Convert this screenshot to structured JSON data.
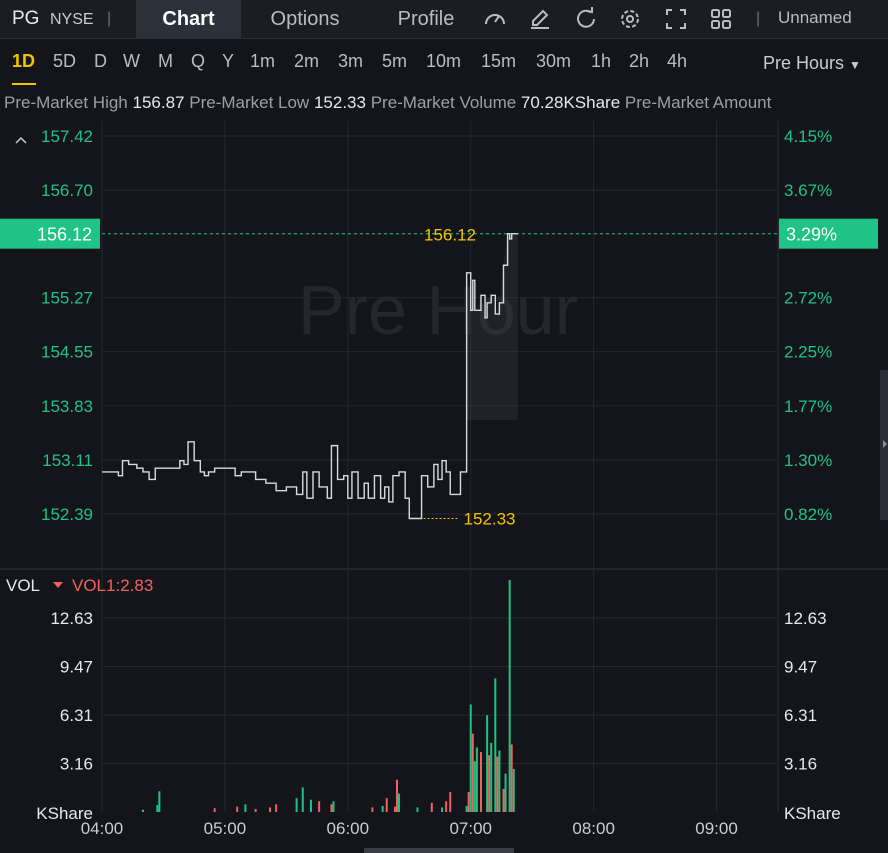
{
  "header": {
    "symbol": "PG",
    "exchange": "NYSE",
    "separator": "|",
    "tabs": [
      {
        "label": "Chart",
        "active": true
      },
      {
        "label": "Options",
        "active": false
      },
      {
        "label": "Profile",
        "active": false
      }
    ],
    "toolbar_icons": [
      "gauge-icon",
      "pen-icon",
      "refresh-icon",
      "gear-icon",
      "fullscreen-icon",
      "grid-icon"
    ],
    "layout_name": "Unnamed",
    "tab_active_bg": "#2c3038"
  },
  "timeframes": {
    "items": [
      "1D",
      "5D",
      "D",
      "W",
      "M",
      "Q",
      "Y",
      "1m",
      "2m",
      "3m",
      "5m",
      "10m",
      "15m",
      "30m",
      "1h",
      "2h",
      "4h"
    ],
    "active": "1D",
    "session_select": "Pre Hours"
  },
  "stats": [
    {
      "label": "Pre-Market High",
      "value": "156.87"
    },
    {
      "label": "Pre-Market Low",
      "value": "152.33"
    },
    {
      "label": "Pre-Market Volume",
      "value": "70.28KShare"
    },
    {
      "label": "Pre-Market Amount",
      "value": ""
    }
  ],
  "chart_data": [
    {
      "type": "line",
      "title": "",
      "watermark": "Pre Hour",
      "x_ticks": [
        "04:00",
        "05:00",
        "06:00",
        "07:00",
        "08:00",
        "09:00"
      ],
      "xlim": [
        "04:00",
        "09:30"
      ],
      "price_ticks": [
        "157.42",
        "156.70",
        "155.27",
        "154.55",
        "153.83",
        "153.11",
        "152.39"
      ],
      "percent_ticks": [
        "4.15%",
        "3.67%",
        "2.72%",
        "2.25%",
        "1.77%",
        "1.30%",
        "0.82%"
      ],
      "ylim": [
        151.9,
        157.5
      ],
      "current_price": "156.12",
      "current_percent": "3.29%",
      "current_label": "156.12",
      "low_label": "152.33",
      "low_time": "06:35",
      "series": [
        {
          "x": [
            "04:00",
            "04:08",
            "04:10",
            "04:13",
            "04:17",
            "04:20",
            "04:23",
            "04:26",
            "04:30",
            "04:35",
            "04:38",
            "04:40",
            "04:42",
            "04:45",
            "04:48",
            "04:50",
            "04:52",
            "04:55",
            "05:00",
            "05:05",
            "05:08",
            "05:12",
            "05:15",
            "05:20",
            "05:25",
            "05:30",
            "05:35",
            "05:38",
            "05:40",
            "05:43",
            "05:46",
            "05:50",
            "05:52",
            "05:55",
            "05:58",
            "06:00",
            "06:02",
            "06:05",
            "06:08",
            "06:10",
            "06:13",
            "06:16",
            "06:18",
            "06:20",
            "06:22",
            "06:25",
            "06:28",
            "06:30",
            "06:33",
            "06:36",
            "06:39",
            "06:42",
            "06:44",
            "06:46",
            "06:48",
            "06:50",
            "06:52",
            "06:55",
            "06:58",
            "07:00",
            "07:01",
            "07:02",
            "07:03",
            "07:05",
            "07:07",
            "07:08",
            "07:10",
            "07:12",
            "07:14",
            "07:16",
            "07:18",
            "07:19",
            "07:20",
            "07:22",
            "07:23"
          ],
          "y": [
            152.95,
            152.9,
            153.1,
            153.05,
            153.0,
            152.95,
            152.85,
            153.0,
            153.0,
            153.0,
            153.1,
            153.05,
            153.35,
            153.1,
            152.95,
            152.9,
            152.95,
            153.0,
            153.0,
            152.9,
            152.95,
            152.95,
            152.85,
            152.8,
            152.7,
            152.75,
            152.65,
            152.95,
            152.6,
            152.95,
            152.75,
            152.6,
            153.3,
            152.85,
            152.9,
            152.6,
            152.95,
            152.6,
            152.8,
            152.6,
            152.9,
            152.6,
            152.75,
            152.55,
            152.9,
            152.95,
            152.6,
            152.33,
            152.33,
            152.9,
            152.75,
            153.05,
            152.85,
            153.1,
            152.95,
            152.65,
            152.65,
            152.95,
            155.6,
            155.1,
            155.5,
            155.1,
            155.1,
            155.3,
            155.0,
            155.2,
            155.3,
            155.05,
            155.2,
            155.7,
            156.12,
            156.05,
            156.12,
            156.12,
            156.12
          ]
        }
      ]
    },
    {
      "type": "bar",
      "title": "VOL",
      "indicator": "VOL1:2.83",
      "unit": "KShare",
      "y_ticks": [
        "12.63",
        "9.47",
        "6.31",
        "3.16"
      ],
      "ylim": [
        0,
        15.2
      ],
      "series": [
        {
          "x": [
            "04:20",
            "04:27",
            "04:28",
            "04:55",
            "05:06",
            "05:10",
            "05:15",
            "05:22",
            "05:25",
            "05:35",
            "05:38",
            "05:42",
            "05:46",
            "05:52",
            "05:53",
            "06:12",
            "06:17",
            "06:19",
            "06:23",
            "06:24",
            "06:25",
            "06:34",
            "06:41",
            "06:46",
            "06:48",
            "06:50",
            "06:58",
            "06:59",
            "07:00",
            "07:01",
            "07:02",
            "07:03",
            "07:05",
            "07:08",
            "07:09",
            "07:10",
            "07:12",
            "07:13",
            "07:14",
            "07:16",
            "07:17",
            "07:19",
            "07:20",
            "07:21"
          ],
          "volume": [
            0.15,
            0.45,
            1.35,
            0.25,
            0.35,
            0.5,
            0.2,
            0.3,
            0.5,
            0.9,
            1.6,
            0.8,
            0.7,
            0.5,
            0.7,
            0.3,
            0.4,
            0.9,
            0.35,
            2.1,
            1.2,
            0.3,
            0.6,
            0.3,
            0.7,
            1.3,
            0.4,
            1.3,
            7.0,
            5.1,
            3.3,
            4.2,
            3.9,
            6.3,
            3.7,
            4.5,
            8.7,
            3.6,
            4.0,
            1.5,
            2.5,
            15.1,
            4.4,
            2.8
          ],
          "direction": [
            "up",
            "up",
            "up",
            "down",
            "down",
            "up",
            "down",
            "down",
            "down",
            "up",
            "up",
            "up",
            "down",
            "down",
            "up",
            "down",
            "up",
            "down",
            "down",
            "down",
            "up",
            "up",
            "down",
            "up",
            "down",
            "down",
            "up",
            "down",
            "up",
            "down",
            "up",
            "up",
            "down",
            "up",
            "down",
            "up",
            "up",
            "down",
            "up",
            "down",
            "up",
            "up",
            "down",
            "up"
          ]
        }
      ]
    }
  ],
  "colors": {
    "up": "#1fc385",
    "down": "#f2625c",
    "price_label_bg": "#1fc385",
    "accent": "#f2c500",
    "line": "#d8dade"
  }
}
